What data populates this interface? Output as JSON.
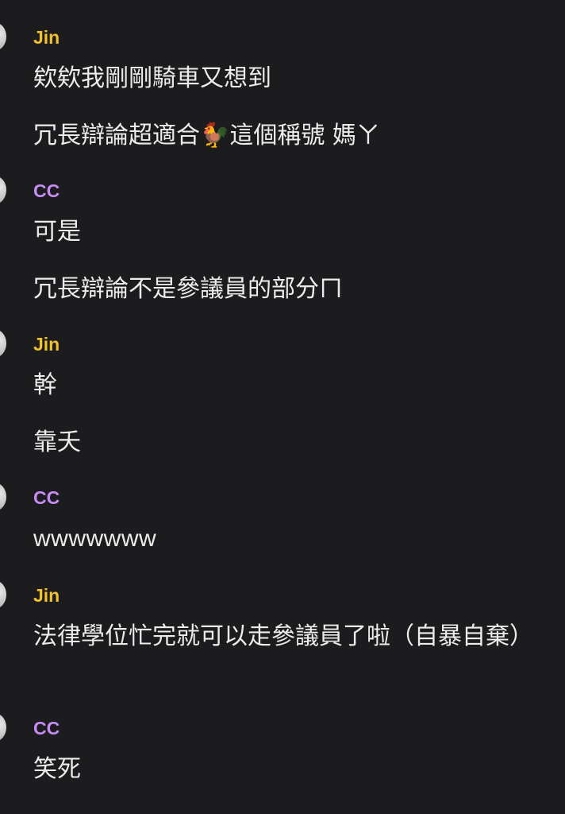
{
  "messages": [
    {
      "author": "Jin",
      "lines": [
        "欸欸我剛剛騎車又想到"
      ]
    },
    {
      "author": "",
      "lines_before_emoji": "冗長辯論超適合",
      "emoji": "🐓",
      "lines_after_emoji": "這個稱號 媽ㄚ"
    },
    {
      "author": "CC",
      "lines": [
        "可是",
        "冗長辯論不是參議員的部分ㄇ"
      ]
    },
    {
      "author": "Jin",
      "lines": [
        "幹",
        "靠夭"
      ]
    },
    {
      "author": "CC",
      "lines": [
        "wwwwwww"
      ]
    },
    {
      "author": "Jin",
      "lines": [
        "法律學位忙完就可以走參議員了啦（自暴自棄）"
      ]
    },
    {
      "author": "CC",
      "lines": [
        "笑死"
      ]
    }
  ],
  "colors": {
    "background": "#1c1c1e",
    "text": "#ececec",
    "jin": "#f2c12e",
    "cc": "#c68cf5"
  },
  "icons": {
    "avatar": "user-avatar-icon",
    "emoji": "rooster-emoji"
  }
}
